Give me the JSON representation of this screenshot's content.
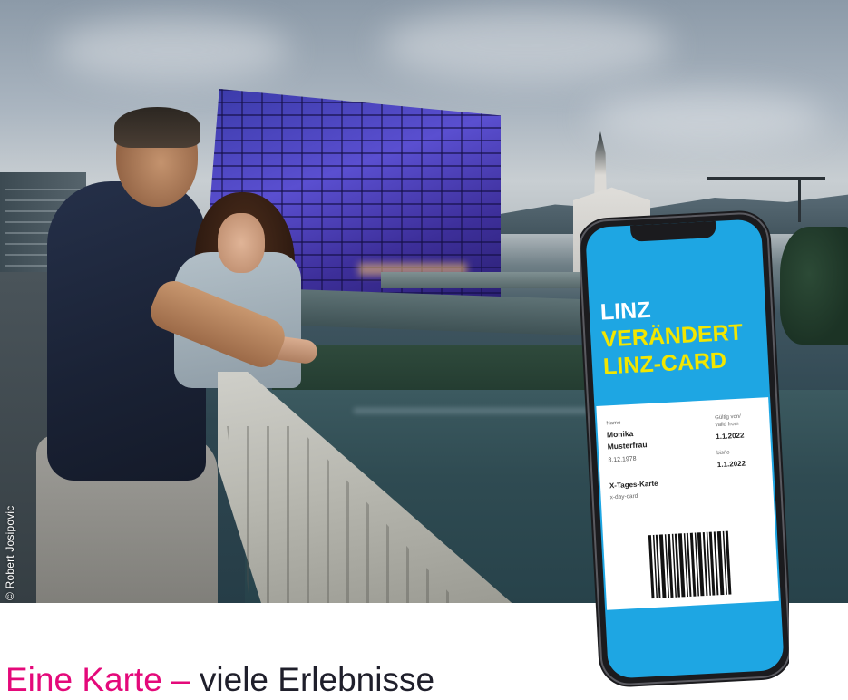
{
  "photo": {
    "credit": "© Robert Josipovic"
  },
  "card": {
    "line1": "LINZ",
    "line2": "VERÄNDERT",
    "line3": "LINZ-CARD",
    "name_label": "Name",
    "first_name": "Monika",
    "last_name": "Musterfrau",
    "birth_date": "8.12.1978",
    "valid_from_label_de": "Gültig von/",
    "valid_from_label_en": "valid from",
    "valid_from": "1.1.2022",
    "valid_to_label": "bis/to",
    "valid_to": "1.1.2022",
    "ticket_type_de": "X-Tages-Karte",
    "ticket_type_en": "x-day-card"
  },
  "headline": {
    "accent": "Eine Karte – ",
    "rest": "viele Erlebnisse"
  },
  "colors": {
    "card_blue": "#1ea6e3",
    "card_yellow": "#f2e600",
    "headline_accent": "#e4097a",
    "headline_text": "#1f1f2b"
  }
}
